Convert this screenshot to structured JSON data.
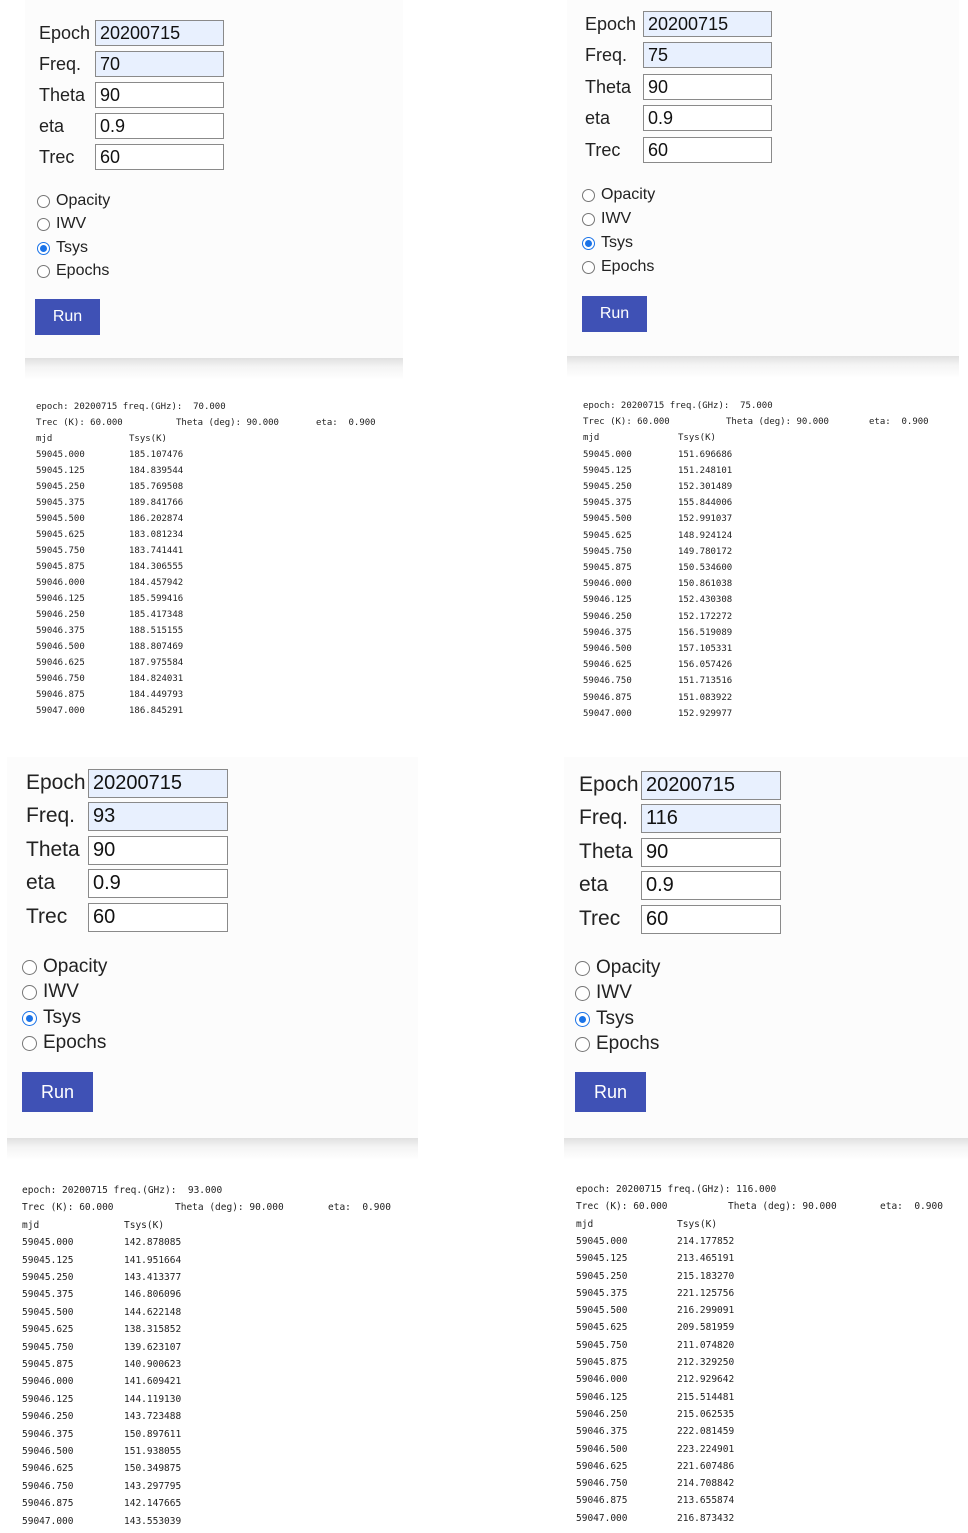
{
  "panels": [
    {
      "form": {
        "epoch_label": "Epoch",
        "epoch_value": "20200715",
        "freq_label": "Freq.",
        "freq_value": "70",
        "theta_label": "Theta",
        "theta_value": "90",
        "eta_label": "eta",
        "eta_value": "0.9",
        "trec_label": "Trec",
        "trec_value": "60",
        "radios": [
          "Opacity",
          "IWV",
          "Tsys",
          "Epochs"
        ],
        "selected": "Tsys",
        "run_label": "Run"
      },
      "output": {
        "header1": "epoch: 20200715 freq.(GHz):  70.000",
        "header2_left": "Trec (K): 60.000",
        "header2_mid": "Theta (deg): 90.000",
        "header2_right": "eta:  0.900",
        "col_mjd": "mjd",
        "col_val": "Tsys(K)",
        "rows": [
          [
            "59045.000",
            "185.107476"
          ],
          [
            "59045.125",
            "184.839544"
          ],
          [
            "59045.250",
            "185.769508"
          ],
          [
            "59045.375",
            "189.841766"
          ],
          [
            "59045.500",
            "186.202874"
          ],
          [
            "59045.625",
            "183.081234"
          ],
          [
            "59045.750",
            "183.741441"
          ],
          [
            "59045.875",
            "184.306555"
          ],
          [
            "59046.000",
            "184.457942"
          ],
          [
            "59046.125",
            "185.599416"
          ],
          [
            "59046.250",
            "185.417348"
          ],
          [
            "59046.375",
            "188.515155"
          ],
          [
            "59046.500",
            "188.807469"
          ],
          [
            "59046.625",
            "187.975584"
          ],
          [
            "59046.750",
            "184.824031"
          ],
          [
            "59046.875",
            "184.449793"
          ],
          [
            "59047.000",
            "186.845291"
          ]
        ]
      }
    },
    {
      "form": {
        "epoch_label": "Epoch",
        "epoch_value": "20200715",
        "freq_label": "Freq.",
        "freq_value": "75",
        "theta_label": "Theta",
        "theta_value": "90",
        "eta_label": "eta",
        "eta_value": "0.9",
        "trec_label": "Trec",
        "trec_value": "60",
        "radios": [
          "Opacity",
          "IWV",
          "Tsys",
          "Epochs"
        ],
        "selected": "Tsys",
        "run_label": "Run"
      },
      "output": {
        "header1": "epoch: 20200715 freq.(GHz):  75.000",
        "header2_left": "Trec (K): 60.000",
        "header2_mid": "Theta (deg): 90.000",
        "header2_right": "eta:  0.900",
        "col_mjd": "mjd",
        "col_val": "Tsys(K)",
        "rows": [
          [
            "59045.000",
            "151.696686"
          ],
          [
            "59045.125",
            "151.248101"
          ],
          [
            "59045.250",
            "152.301489"
          ],
          [
            "59045.375",
            "155.844006"
          ],
          [
            "59045.500",
            "152.991037"
          ],
          [
            "59045.625",
            "148.924124"
          ],
          [
            "59045.750",
            "149.780172"
          ],
          [
            "59045.875",
            "150.534600"
          ],
          [
            "59046.000",
            "150.861038"
          ],
          [
            "59046.125",
            "152.430308"
          ],
          [
            "59046.250",
            "152.172272"
          ],
          [
            "59046.375",
            "156.519089"
          ],
          [
            "59046.500",
            "157.105331"
          ],
          [
            "59046.625",
            "156.057426"
          ],
          [
            "59046.750",
            "151.713516"
          ],
          [
            "59046.875",
            "151.083922"
          ],
          [
            "59047.000",
            "152.929977"
          ]
        ]
      }
    },
    {
      "form": {
        "epoch_label": "Epoch",
        "epoch_value": "20200715",
        "freq_label": "Freq.",
        "freq_value": "93",
        "theta_label": "Theta",
        "theta_value": "90",
        "eta_label": "eta",
        "eta_value": "0.9",
        "trec_label": "Trec",
        "trec_value": "60",
        "radios": [
          "Opacity",
          "IWV",
          "Tsys",
          "Epochs"
        ],
        "selected": "Tsys",
        "run_label": "Run"
      },
      "output": {
        "header1": "epoch: 20200715 freq.(GHz):  93.000",
        "header2_left": "Trec (K): 60.000",
        "header2_mid": "Theta (deg): 90.000",
        "header2_right": "eta:  0.900",
        "col_mjd": "mjd",
        "col_val": "Tsys(K)",
        "rows": [
          [
            "59045.000",
            "142.878085"
          ],
          [
            "59045.125",
            "141.951664"
          ],
          [
            "59045.250",
            "143.413377"
          ],
          [
            "59045.375",
            "146.806096"
          ],
          [
            "59045.500",
            "144.622148"
          ],
          [
            "59045.625",
            "138.315852"
          ],
          [
            "59045.750",
            "139.623107"
          ],
          [
            "59045.875",
            "140.900623"
          ],
          [
            "59046.000",
            "141.609421"
          ],
          [
            "59046.125",
            "144.119130"
          ],
          [
            "59046.250",
            "143.723488"
          ],
          [
            "59046.375",
            "150.897611"
          ],
          [
            "59046.500",
            "151.938055"
          ],
          [
            "59046.625",
            "150.349875"
          ],
          [
            "59046.750",
            "143.297795"
          ],
          [
            "59046.875",
            "142.147665"
          ],
          [
            "59047.000",
            "143.553039"
          ]
        ]
      }
    },
    {
      "form": {
        "epoch_label": "Epoch",
        "epoch_value": "20200715",
        "freq_label": "Freq.",
        "freq_value": "116",
        "theta_label": "Theta",
        "theta_value": "90",
        "eta_label": "eta",
        "eta_value": "0.9",
        "trec_label": "Trec",
        "trec_value": "60",
        "radios": [
          "Opacity",
          "IWV",
          "Tsys",
          "Epochs"
        ],
        "selected": "Tsys",
        "run_label": "Run"
      },
      "output": {
        "header1": "epoch: 20200715 freq.(GHz): 116.000",
        "header2_left": "Trec (K): 60.000",
        "header2_mid": "Theta (deg): 90.000",
        "header2_right": "eta:  0.900",
        "col_mjd": "mjd",
        "col_val": "Tsys(K)",
        "rows": [
          [
            "59045.000",
            "214.177852"
          ],
          [
            "59045.125",
            "213.465191"
          ],
          [
            "59045.250",
            "215.183270"
          ],
          [
            "59045.375",
            "221.125756"
          ],
          [
            "59045.500",
            "216.299091"
          ],
          [
            "59045.625",
            "209.581959"
          ],
          [
            "59045.750",
            "211.074820"
          ],
          [
            "59045.875",
            "212.329250"
          ],
          [
            "59046.000",
            "212.929642"
          ],
          [
            "59046.125",
            "215.514481"
          ],
          [
            "59046.250",
            "215.062535"
          ],
          [
            "59046.375",
            "222.081459"
          ],
          [
            "59046.500",
            "223.224901"
          ],
          [
            "59046.625",
            "221.607486"
          ],
          [
            "59046.750",
            "214.708842"
          ],
          [
            "59046.875",
            "213.655874"
          ],
          [
            "59047.000",
            "216.873432"
          ]
        ]
      }
    }
  ],
  "colors": {
    "run_button": "#3f51b5",
    "radio_selected": "#1a73e8",
    "autofill": "#e8f0fe"
  }
}
